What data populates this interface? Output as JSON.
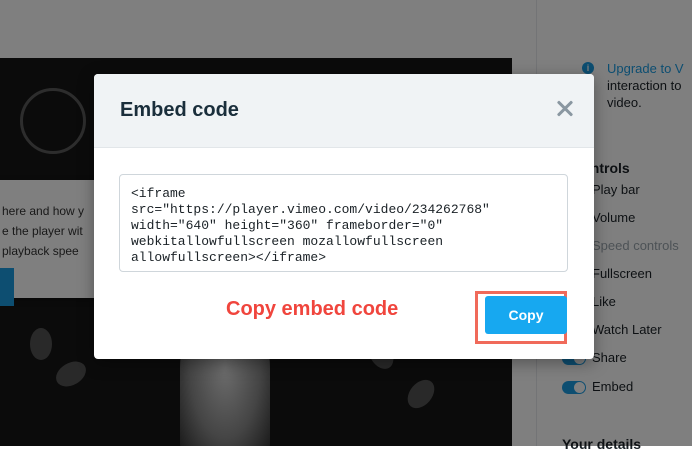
{
  "background": {
    "card_lines": [
      "here and how y",
      "e the player wit",
      "playback spee"
    ],
    "upgrade": {
      "line1": "Upgrade to V",
      "line2": "interaction to",
      "line3": "video."
    },
    "controls_heading": "o controls",
    "controls": [
      {
        "label": "Play bar",
        "on": true
      },
      {
        "label": "Volume",
        "on": true
      },
      {
        "label": "Speed controls",
        "on": false
      },
      {
        "label": "Fullscreen",
        "on": true
      },
      {
        "label": "Like",
        "on": true
      },
      {
        "label": "Watch Later",
        "on": true
      },
      {
        "label": "Share",
        "on": true
      },
      {
        "label": "Embed",
        "on": true
      }
    ],
    "details_heading": "Your details"
  },
  "modal": {
    "title": "Embed code",
    "close_icon": "close-icon",
    "embed_code": "<iframe\nsrc=\"https://player.vimeo.com/video/234262768\"\nwidth=\"640\" height=\"360\" frameborder=\"0\"\nwebkitallowfullscreen mozallowfullscreen\nallowfullscreen></iframe>",
    "copy_label": "Copy"
  },
  "annotation": {
    "label": "Copy embed code",
    "color": "#f0453d"
  },
  "colors": {
    "accent": "#17a8f0",
    "highlight": "#f06a5a"
  }
}
